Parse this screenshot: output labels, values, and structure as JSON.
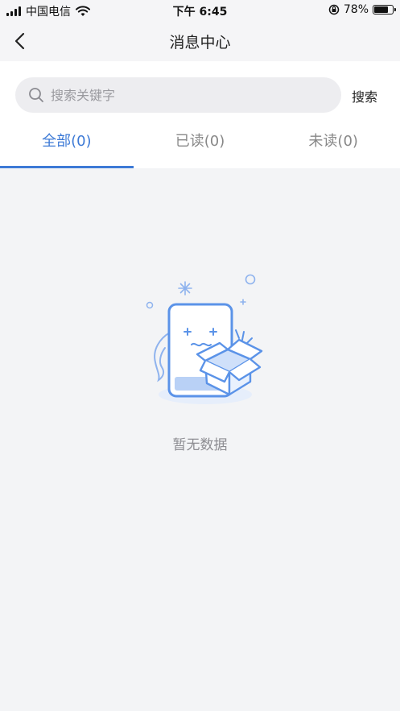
{
  "status_bar": {
    "carrier": "中国电信",
    "time": "下午 6:45",
    "battery_percent": "78%",
    "battery_level": 0.78
  },
  "nav": {
    "title": "消息中心"
  },
  "search": {
    "placeholder": "搜索关键字",
    "value": "",
    "button_label": "搜索"
  },
  "tabs": [
    {
      "label": "全部(0)",
      "active": true
    },
    {
      "label": "已读(0)",
      "active": false
    },
    {
      "label": "未读(0)",
      "active": false
    }
  ],
  "empty_state": {
    "message": "暂无数据"
  },
  "colors": {
    "accent": "#3d7ad6",
    "background": "#f3f4f6",
    "illustration": "#5b93e8"
  }
}
